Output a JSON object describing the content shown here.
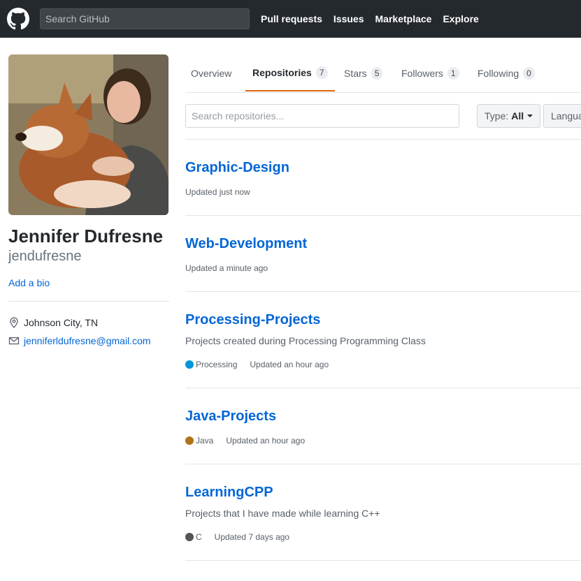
{
  "header": {
    "search_placeholder": "Search GitHub",
    "nav": [
      "Pull requests",
      "Issues",
      "Marketplace",
      "Explore"
    ]
  },
  "profile": {
    "name": "Jennifer Dufresne",
    "login": "jendufresne",
    "bio_link": "Add a bio",
    "location": "Johnson City, TN",
    "email": "jenniferldufresne@gmail.com"
  },
  "tabs": [
    {
      "label": "Overview",
      "count": ""
    },
    {
      "label": "Repositories",
      "count": "7"
    },
    {
      "label": "Stars",
      "count": "5"
    },
    {
      "label": "Followers",
      "count": "1"
    },
    {
      "label": "Following",
      "count": "0"
    }
  ],
  "filters": {
    "search_placeholder": "Search repositories...",
    "type_label": "Type:",
    "type_value": "All",
    "language_label": "Langua"
  },
  "repos": [
    {
      "name": "Graphic-Design",
      "description": "",
      "language": "",
      "language_color": "",
      "updated": "Updated just now"
    },
    {
      "name": "Web-Development",
      "description": "",
      "language": "",
      "language_color": "",
      "updated": "Updated a minute ago"
    },
    {
      "name": "Processing-Projects",
      "description": "Projects created during Processing Programming Class",
      "language": "Processing",
      "language_color": "#0096d8",
      "updated": "Updated an hour ago"
    },
    {
      "name": "Java-Projects",
      "description": "",
      "language": "Java",
      "language_color": "#b07219",
      "updated": "Updated an hour ago"
    },
    {
      "name": "LearningCPP",
      "description": "Projects that I have made while learning C++",
      "language": "C",
      "language_color": "#555555",
      "updated": "Updated 7 days ago"
    }
  ]
}
